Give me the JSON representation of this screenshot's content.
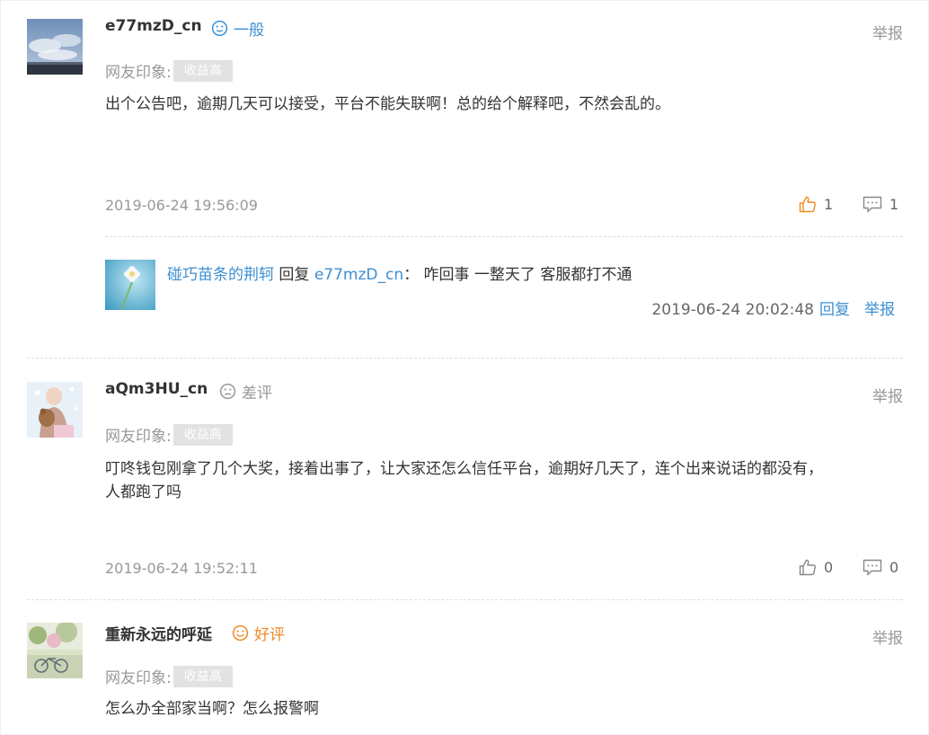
{
  "comments": [
    {
      "user": "e77mzD_cn",
      "rating": {
        "label": "一般",
        "icon": "neutral-face-icon",
        "color": "#3d8fd1"
      },
      "report": "举报",
      "impression_label": "网友印象:",
      "tag": "收益高",
      "text": "出个公告吧，逾期几天可以接受，平台不能失联啊！总的给个解释吧，不然会乱的。",
      "time": "2019-06-24 19:56:09",
      "likes": "1",
      "replies_count": "1",
      "reply": {
        "user": "碰巧苗条的荆轲",
        "reply_word": "回复",
        "target": "e77mzD_cn",
        "colon": "：",
        "text": "咋回事 一整天了 客服都打不通",
        "time": "2019-06-24 20:02:48",
        "reply_btn": "回复",
        "report_btn": "举报"
      }
    },
    {
      "user": "aQm3HU_cn",
      "rating": {
        "label": "差评",
        "icon": "sad-face-icon",
        "color": "#999999"
      },
      "report": "举报",
      "impression_label": "网友印象:",
      "tag": "收益高",
      "text_line1": "叮咚钱包刚拿了几个大奖，接着出事了，让大家还怎么信任平台，逾期好几天了，连个出来说话的都没有，",
      "text_line2": "人都跑了吗",
      "time": "2019-06-24 19:52:11",
      "likes": "0",
      "replies_count": "0"
    },
    {
      "user": "重新永远的呼延",
      "rating": {
        "label": "好评",
        "icon": "happy-face-icon",
        "color": "#f08a24"
      },
      "report": "举报",
      "impression_label": "网友印象:",
      "tag": "收益高",
      "text": "怎么办全部家当啊？怎么报警啊"
    }
  ]
}
